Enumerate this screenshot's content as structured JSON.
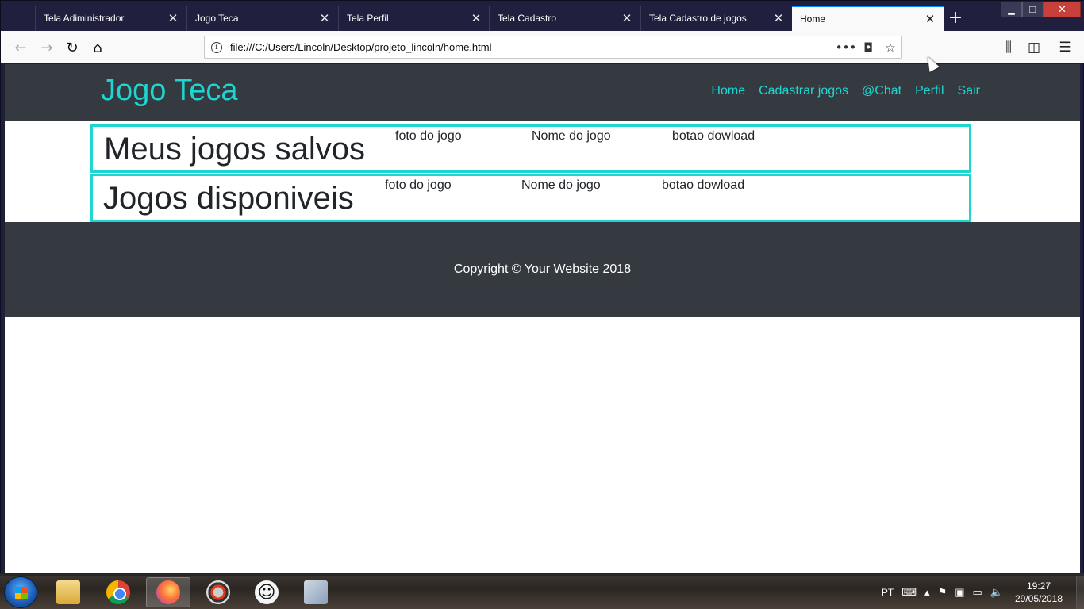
{
  "browser": {
    "tabs": [
      {
        "title": "Tela Adiministrador"
      },
      {
        "title": "Jogo Teca"
      },
      {
        "title": "Tela Perfil"
      },
      {
        "title": "Tela Cadastro"
      },
      {
        "title": "Tela Cadastro de jogos"
      },
      {
        "title": "Home",
        "active": true
      }
    ],
    "url": "file:///C:/Users/Lincoln/Desktop/projeto_lincoln/home.html",
    "accent_color": "#0a84ff"
  },
  "site": {
    "brand": "Jogo Teca",
    "brand_color": "#1fd5d2",
    "nav": [
      "Home",
      "Cadastrar jogos",
      "@Chat",
      "Perfil",
      "Sair"
    ],
    "sections": [
      {
        "title": "Meus jogos salvos",
        "col1": "foto do jogo",
        "col2": "Nome do jogo",
        "col3": "botao dowload"
      },
      {
        "title": "Jogos disponiveis",
        "col1": "foto do jogo",
        "col2": "Nome do jogo",
        "col3": "botao dowload"
      }
    ],
    "footer": "Copyright © Your Website 2018",
    "dark_color": "#343a40"
  },
  "taskbar": {
    "lang": "PT",
    "time": "19:27",
    "date": "29/05/2018"
  }
}
